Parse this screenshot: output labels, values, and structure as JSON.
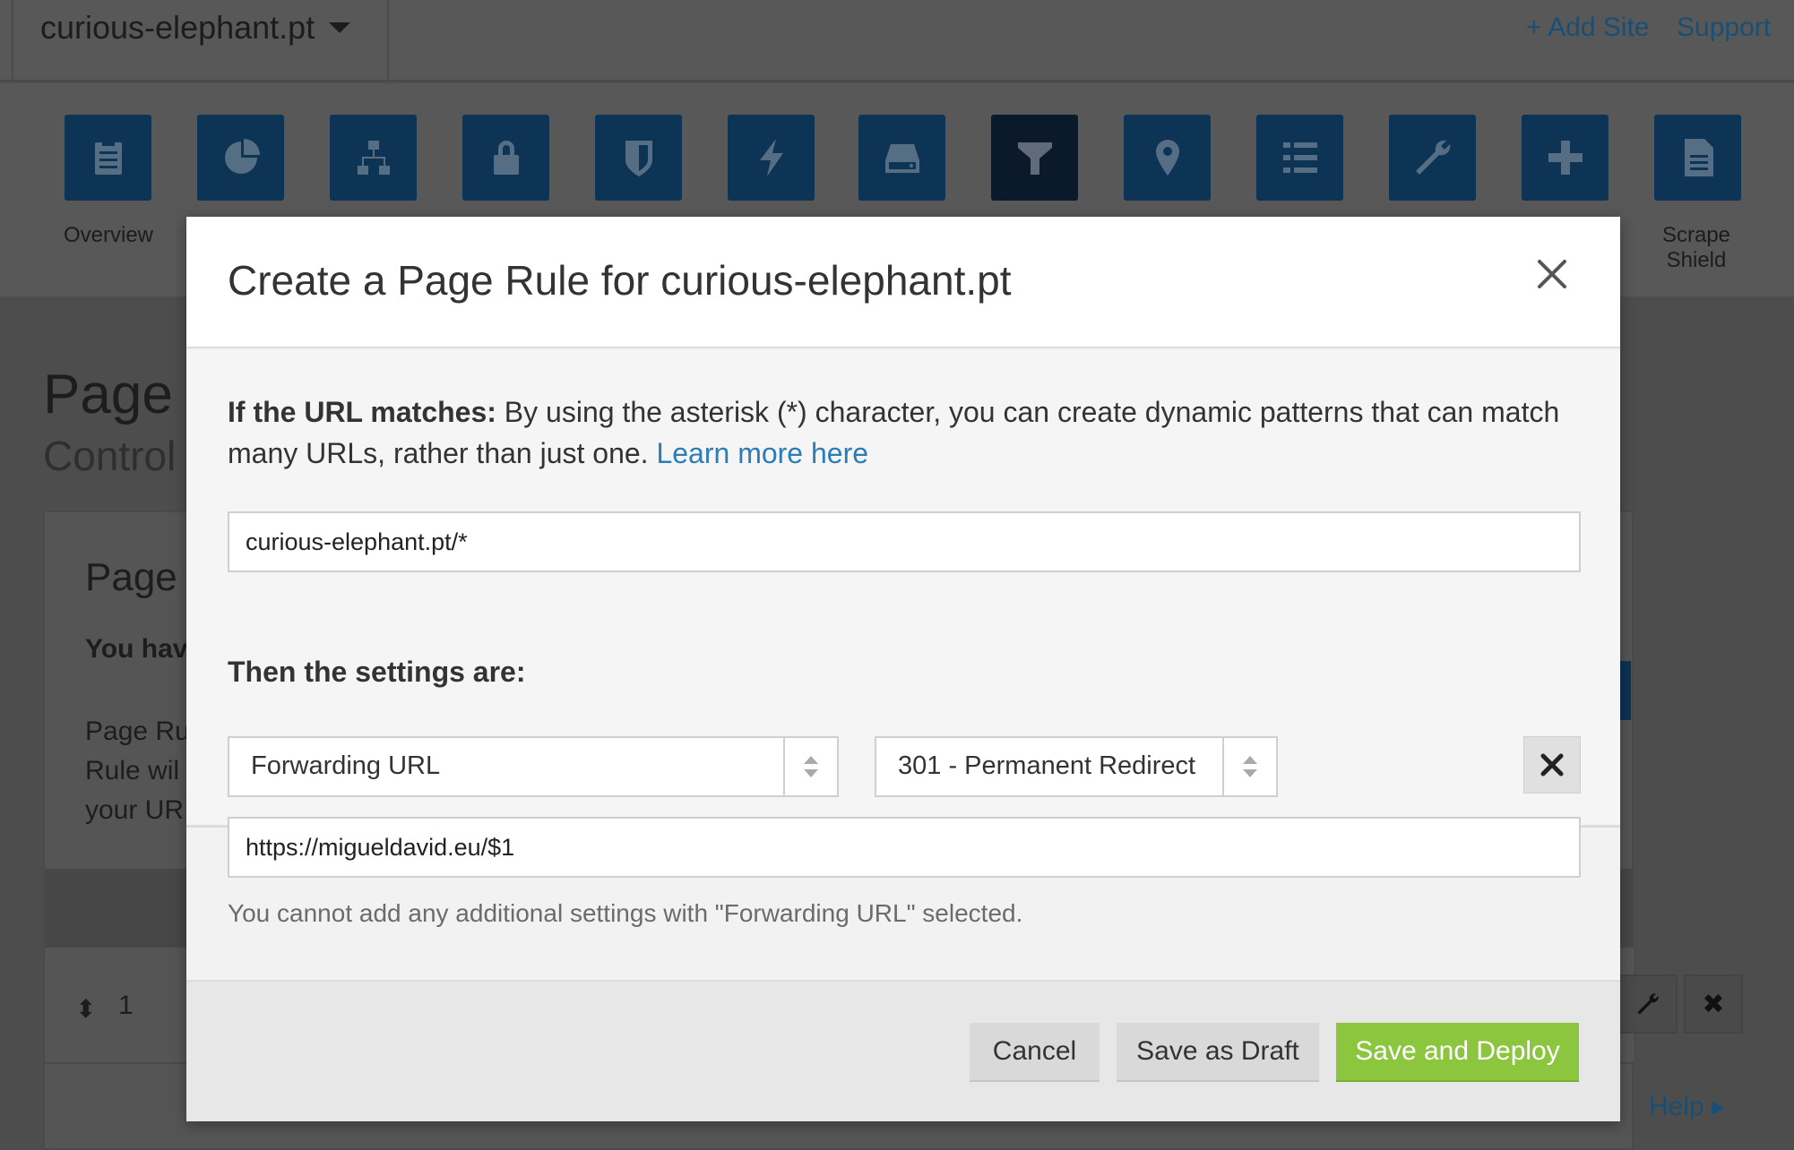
{
  "topbar": {
    "site_name": "curious-elephant.pt",
    "add_site": "+ Add Site",
    "support": "Support"
  },
  "apps": [
    {
      "icon": "overview-icon",
      "label": "Overview"
    },
    {
      "icon": "analytics-icon",
      "label": ""
    },
    {
      "icon": "dns-icon",
      "label": ""
    },
    {
      "icon": "crypto-icon",
      "label": ""
    },
    {
      "icon": "firewall-icon",
      "label": ""
    },
    {
      "icon": "speed-icon",
      "label": ""
    },
    {
      "icon": "caching-icon",
      "label": ""
    },
    {
      "icon": "page-rules-icon",
      "label": "",
      "active": true
    },
    {
      "icon": "traffic-icon",
      "label": ""
    },
    {
      "icon": "customize-icon",
      "label": ""
    },
    {
      "icon": "apps-wrench-icon",
      "label": ""
    },
    {
      "icon": "apps-plus-icon",
      "label": ""
    },
    {
      "icon": "scrape-shield-icon",
      "label": "Scrape\nShield"
    }
  ],
  "background": {
    "heading": "Page R",
    "subheading": "Control",
    "panel_title": "Page",
    "panel_bold": "You hav",
    "panel_para": [
      "Page Ru",
      "Rule wil",
      "your UR"
    ],
    "row_number": "1",
    "help_link": "Help ▸"
  },
  "modal": {
    "title": "Create a Page Rule for curious-elephant.pt",
    "url_match_label": "If the URL matches:",
    "url_match_text": " By using the asterisk (*) character, you can create dynamic patterns that can match many URLs, rather than just one. ",
    "learn_more": "Learn more here",
    "url_value": "curious-elephant.pt/*",
    "settings_label": "Then the settings are:",
    "setting_select": "Forwarding URL",
    "status_select": "301 - Permanent Redirect",
    "destination_value": "https://migueldavid.eu/$1",
    "note": "You cannot add any additional settings with \"Forwarding URL\" selected.",
    "buttons": {
      "cancel": "Cancel",
      "draft": "Save as Draft",
      "deploy": "Save and Deploy"
    }
  },
  "colors": {
    "accent_blue": "#0d3355",
    "link_blue": "#2c7cb8",
    "deploy_green": "#8cc63f"
  }
}
